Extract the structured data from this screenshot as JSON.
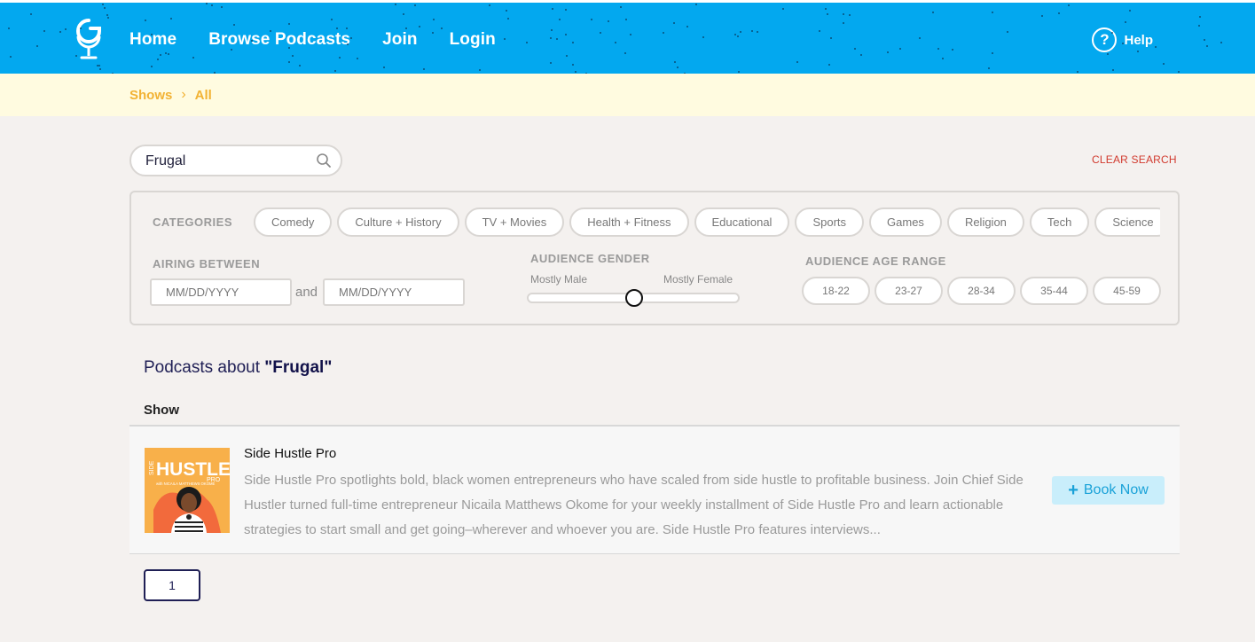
{
  "nav": {
    "links": [
      "Home",
      "Browse Podcasts",
      "Join",
      "Login"
    ],
    "help_label": "Help",
    "help_glyph": "?",
    "brand_color": "#03a8ef"
  },
  "breadcrumb": {
    "items": [
      "Shows",
      "All"
    ],
    "separator": "›"
  },
  "search": {
    "value": "Frugal",
    "clear_label": "CLEAR SEARCH"
  },
  "filters": {
    "categories_label": "CATEGORIES",
    "categories": [
      "Comedy",
      "Culture + History",
      "TV + Movies",
      "Health + Fitness",
      "Educational",
      "Sports",
      "Games",
      "Religion",
      "Tech",
      "Science"
    ],
    "airing_label": "AIRING BETWEEN",
    "date_placeholder": "MM/DD/YYYY",
    "and_label": "and",
    "gender_label": "AUDIENCE GENDER",
    "gender_min": "Mostly Male",
    "gender_max": "Mostly Female",
    "gender_value": 0.5,
    "age_label": "AUDIENCE AGE RANGE",
    "ages": [
      "18-22",
      "23-27",
      "28-34",
      "35-44",
      "45-59"
    ]
  },
  "results": {
    "prefix": "Podcasts about ",
    "query": "\"Frugal\"",
    "column_header": "Show",
    "items": [
      {
        "name": "Side Hustle Pro",
        "description": "Side Hustle Pro spotlights bold, black women entrepreneurs who have scaled from side hustle to profitable business. Join Chief Side Hustler turned full-time entrepreneur Nicaila Matthews Okome for your weekly installment of Side Hustle Pro and learn actionable strategies to start small and get going–wherever and whoever you are. Side Hustle Pro features interviews...",
        "action_label": "Book Now",
        "art": {
          "top": "SIDE",
          "main": "HUSTLE",
          "sub": "PRO",
          "byline": "with NICAILA MATTHEWS OKOME"
        }
      }
    ]
  },
  "pagination": {
    "pages": [
      "1"
    ]
  }
}
